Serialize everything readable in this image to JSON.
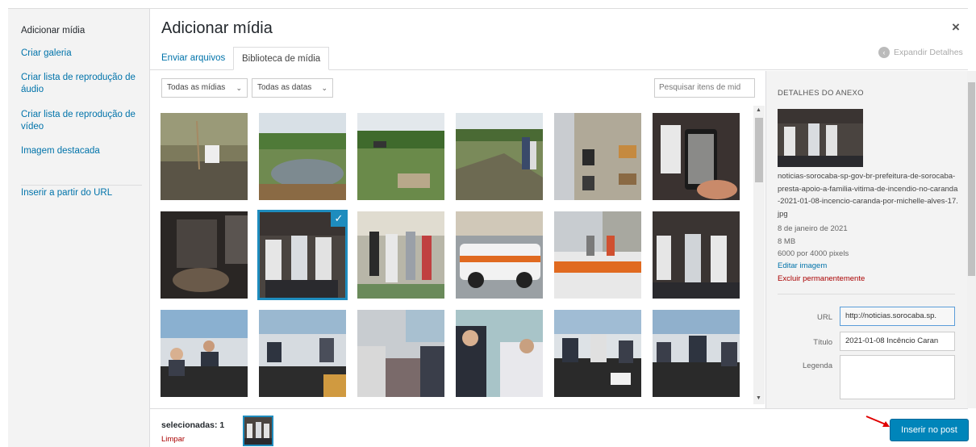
{
  "modal": {
    "title": "Adicionar mídia",
    "close_label": "×",
    "expand_label": "Expandir Detalhes"
  },
  "menu": {
    "items": [
      {
        "label": "Adicionar mídia",
        "active": true
      },
      {
        "label": "Criar galeria"
      },
      {
        "label": "Criar lista de reprodução de áudio"
      },
      {
        "label": "Criar lista de reprodução de vídeo"
      },
      {
        "label": "Imagem destacada"
      },
      {
        "label": "Inserir a partir do URL"
      }
    ]
  },
  "tabs": {
    "upload": "Enviar arquivos",
    "library": "Biblioteca de mídia"
  },
  "toolbar": {
    "filter_type": "Todas as mídias",
    "filter_date": "Todas as datas",
    "search_placeholder": "Pesquisar itens de mid"
  },
  "grid": {
    "selected_index": 7,
    "check_mark": "✓"
  },
  "details": {
    "heading": "DETALHES DO ANEXO",
    "filename": "noticias-sorocaba-sp-gov-br-prefeitura-de-sorocaba-presta-apoio-a-familia-vitima-de-incendio-no-caranda-2021-01-08-incencio-caranda-por-michelle-alves-17.jpg",
    "date": "8 de janeiro de 2021",
    "size": "8 MB",
    "dimensions": "6000 por 4000 pixels",
    "edit_link": "Editar imagem",
    "delete_link": "Excluir permanentemente",
    "url_label": "URL",
    "url_value": "http://noticias.sorocaba.sp.",
    "title_label": "Título",
    "title_value": "2021-01-08 Incêncio Caran",
    "caption_label": "Legenda"
  },
  "footer": {
    "selected_text": "selecionadas: 1",
    "clear_label": "Limpar",
    "insert_button": "Inserir no post"
  },
  "colors": {
    "accent": "#0085ba",
    "link": "#0073aa",
    "danger": "#a00000",
    "selection": "#1e8cbe",
    "annotation_arrow": "#e00000"
  }
}
